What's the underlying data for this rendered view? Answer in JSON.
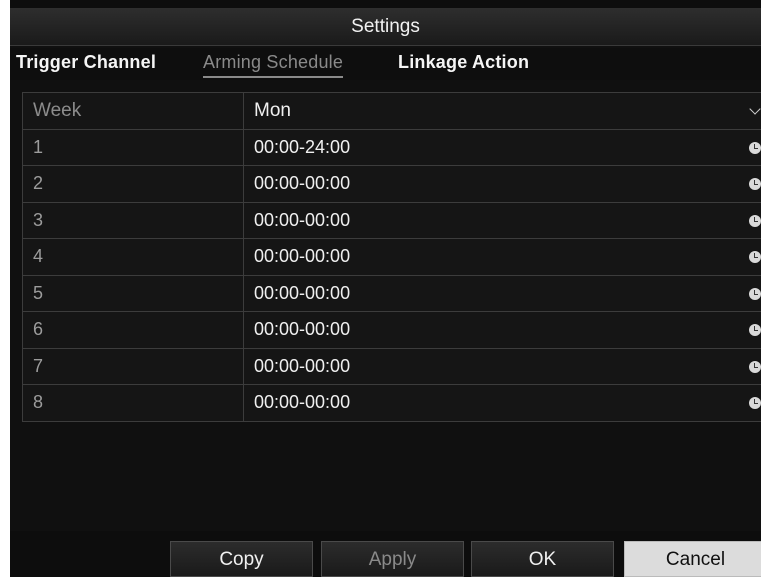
{
  "window": {
    "title": "Settings"
  },
  "tabs": [
    {
      "label": "Trigger Channel"
    },
    {
      "label": "Arming Schedule"
    },
    {
      "label": "Linkage Action"
    }
  ],
  "schedule": {
    "header": {
      "label": "Week",
      "value": "Mon"
    },
    "rows": [
      {
        "index": "1",
        "time": "00:00-24:00"
      },
      {
        "index": "2",
        "time": "00:00-00:00"
      },
      {
        "index": "3",
        "time": "00:00-00:00"
      },
      {
        "index": "4",
        "time": "00:00-00:00"
      },
      {
        "index": "5",
        "time": "00:00-00:00"
      },
      {
        "index": "6",
        "time": "00:00-00:00"
      },
      {
        "index": "7",
        "time": "00:00-00:00"
      },
      {
        "index": "8",
        "time": "00:00-00:00"
      }
    ]
  },
  "buttons": {
    "copy": "Copy",
    "apply": "Apply",
    "ok": "OK",
    "cancel": "Cancel"
  },
  "icons": {
    "time": "clock-icon",
    "dropdown": "chevron-down-icon"
  }
}
